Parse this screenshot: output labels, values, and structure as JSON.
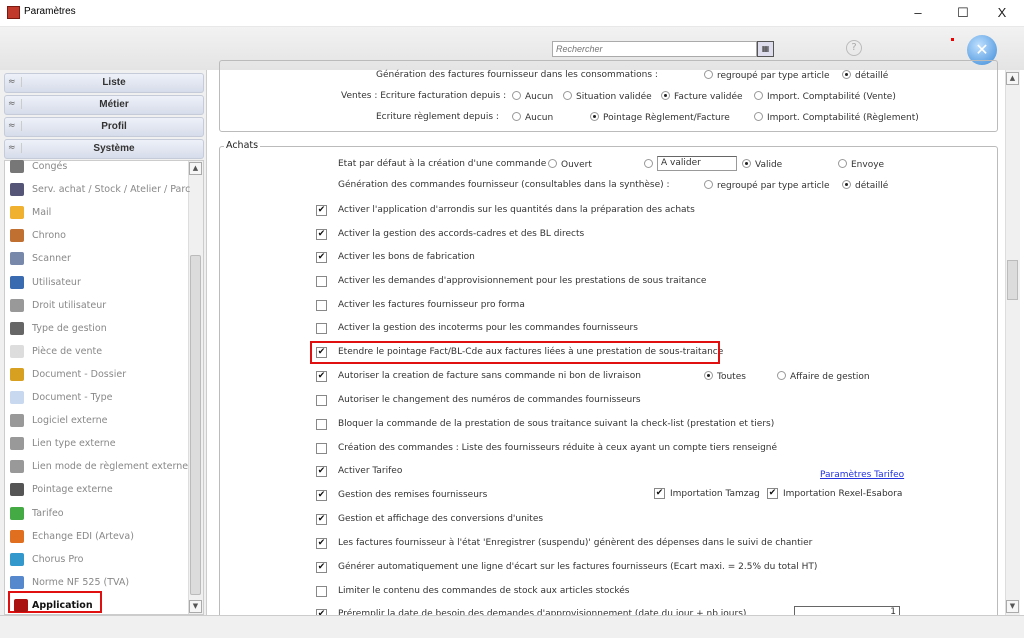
{
  "window": {
    "title": "Paramètres",
    "minimize": "–",
    "maximize": "☐",
    "close": "X"
  },
  "toolbar": {
    "search_placeholder": "Rechercher",
    "help": "?",
    "close_icon": "✕"
  },
  "sidebar": {
    "sections": [
      {
        "label": "Liste",
        "chevron": "≈"
      },
      {
        "label": "Métier",
        "chevron": "≈"
      },
      {
        "label": "Profil",
        "chevron": "≈"
      },
      {
        "label": "Système",
        "chevron": "≈"
      }
    ],
    "items": [
      {
        "label": "Congés",
        "icon": "calendar-icon",
        "color": "#777777"
      },
      {
        "label": "Serv. achat / Stock / Atelier / Parc",
        "icon": "truck-icon",
        "color": "#555577"
      },
      {
        "label": "Mail",
        "icon": "mail-icon",
        "color": "#f0b030"
      },
      {
        "label": "Chrono",
        "icon": "chrono-icon",
        "color": "#c07030"
      },
      {
        "label": "Scanner",
        "icon": "scanner-icon",
        "color": "#7788aa"
      },
      {
        "label": "Utilisateur",
        "icon": "user-icon",
        "color": "#3a6ab0"
      },
      {
        "label": "Droit utilisateur",
        "icon": "lock-icon",
        "color": "#999999"
      },
      {
        "label": "Type de gestion",
        "icon": "tag-icon",
        "color": "#666666"
      },
      {
        "label": "Pièce de vente",
        "icon": "coins-icon",
        "color": "#dddddd"
      },
      {
        "label": "Document - Dossier",
        "icon": "folder-icon",
        "color": "#d8a020"
      },
      {
        "label": "Document - Type",
        "icon": "document-icon",
        "color": "#c8d8ee"
      },
      {
        "label": "Logiciel externe",
        "icon": "software-icon",
        "color": "#999999"
      },
      {
        "label": "Lien type externe",
        "icon": "link-icon",
        "color": "#999999"
      },
      {
        "label": "Lien mode de règlement externe",
        "icon": "payment-link-icon",
        "color": "#999999"
      },
      {
        "label": "Pointage externe",
        "icon": "camera-icon",
        "color": "#555555"
      },
      {
        "label": "Tarifeo",
        "icon": "tarifeo-icon",
        "color": "#44aa44"
      },
      {
        "label": "Echange EDI (Arteva)",
        "icon": "edi-icon",
        "color": "#e07020"
      },
      {
        "label": "Chorus Pro",
        "icon": "chorus-icon",
        "color": "#3399cc"
      },
      {
        "label": "Norme NF 525 (TVA)",
        "icon": "nf525-icon",
        "color": "#5588cc"
      },
      {
        "label": "Application",
        "icon": "app-icon",
        "color": "#aa1111",
        "selected": true
      }
    ]
  },
  "top_group": {
    "rows": [
      {
        "label": "Génération des factures fournisseur dans les consommations :",
        "options": [
          {
            "label": "regroupé par type article",
            "checked": false
          },
          {
            "label": "détaillé",
            "checked": true
          }
        ]
      },
      {
        "label": "Ventes : Ecriture facturation depuis :",
        "options": [
          {
            "label": "Aucun",
            "checked": false
          },
          {
            "label": "Situation validée",
            "checked": false
          },
          {
            "label": "Facture validée",
            "checked": true
          },
          {
            "label": "Import. Comptabilité (Vente)",
            "checked": false
          }
        ]
      },
      {
        "label": "Ecriture règlement depuis :",
        "options": [
          {
            "label": "Aucun",
            "checked": false
          },
          {
            "label": "Pointage Règlement/Facture",
            "checked": true
          },
          {
            "label": "Import. Comptabilité (Règlement)",
            "checked": false
          }
        ]
      }
    ]
  },
  "achats": {
    "title": "Achats",
    "etat": {
      "label": "Etat par défaut à la création d'une commande :",
      "options": [
        {
          "label": "Ouvert",
          "checked": false
        },
        {
          "label": "",
          "checked": false
        },
        {
          "label": "Valide",
          "checked": true
        },
        {
          "label": "Envoye",
          "checked": false
        }
      ],
      "a_valider_value": "A valider"
    },
    "generation": {
      "label": "Génération des commandes fournisseur (consultables dans la synthèse) :",
      "options": [
        {
          "label": "regroupé par type article",
          "checked": false
        },
        {
          "label": "détaillé",
          "checked": true
        }
      ]
    },
    "checks": [
      {
        "label": "Activer l'application d'arrondis sur les quantités dans la préparation des achats",
        "checked": true
      },
      {
        "label": "Activer la gestion des accords-cadres et des BL directs",
        "checked": true
      },
      {
        "label": "Activer les bons de fabrication",
        "checked": true
      },
      {
        "label": "Activer les demandes d'approvisionnement pour les prestations de sous traitance",
        "checked": false
      },
      {
        "label": "Activer les factures fournisseur pro forma",
        "checked": false
      },
      {
        "label": "Activer la gestion des incoterms pour les commandes fournisseurs",
        "checked": false
      },
      {
        "label": "Etendre le pointage Fact/BL-Cde aux factures liées à une prestation de sous-traitance",
        "checked": true
      },
      {
        "label": "Autoriser la creation de facture sans commande ni bon de livraison",
        "checked": true
      },
      {
        "label": "Autoriser le changement des numéros de commandes fournisseurs",
        "checked": false
      },
      {
        "label": "Bloquer la commande de la prestation de sous traitance suivant la check-list (prestation et tiers)",
        "checked": false
      },
      {
        "label": "Création des commandes : Liste des fournisseurs réduite à ceux ayant un compte tiers renseigné",
        "checked": false
      },
      {
        "label": "Activer Tarifeo",
        "checked": true
      },
      {
        "label": "Gestion des remises fournisseurs",
        "checked": true
      },
      {
        "label": "Gestion et affichage des conversions d'unites",
        "checked": true
      },
      {
        "label": "Les factures fournisseur à l'état 'Enregistrer (suspendu)' génèrent des dépenses dans le suivi de chantier",
        "checked": true
      },
      {
        "label": "Générer automatiquement une ligne d'écart sur les factures fournisseurs (Ecart maxi. = 2.5% du total HT)",
        "checked": true
      },
      {
        "label": "Limiter le contenu des commandes de stock aux articles stockés",
        "checked": false
      },
      {
        "label": "Préremplir la date de besoin des demandes d'approvisionnement (date du jour + nb jours)",
        "checked": true
      }
    ],
    "facture_options": [
      {
        "label": "Toutes",
        "checked": true
      },
      {
        "label": "Affaire de gestion",
        "checked": false
      }
    ],
    "tarifeo_link": "Paramètres Tarifeo",
    "imports": [
      {
        "label": "Importation Tamzag",
        "checked": true
      },
      {
        "label": "Importation Rexel-Esabora",
        "checked": true
      }
    ],
    "nb_jours_value": "1"
  },
  "colors": {
    "highlight": "#e01010",
    "link": "#2233dd"
  }
}
